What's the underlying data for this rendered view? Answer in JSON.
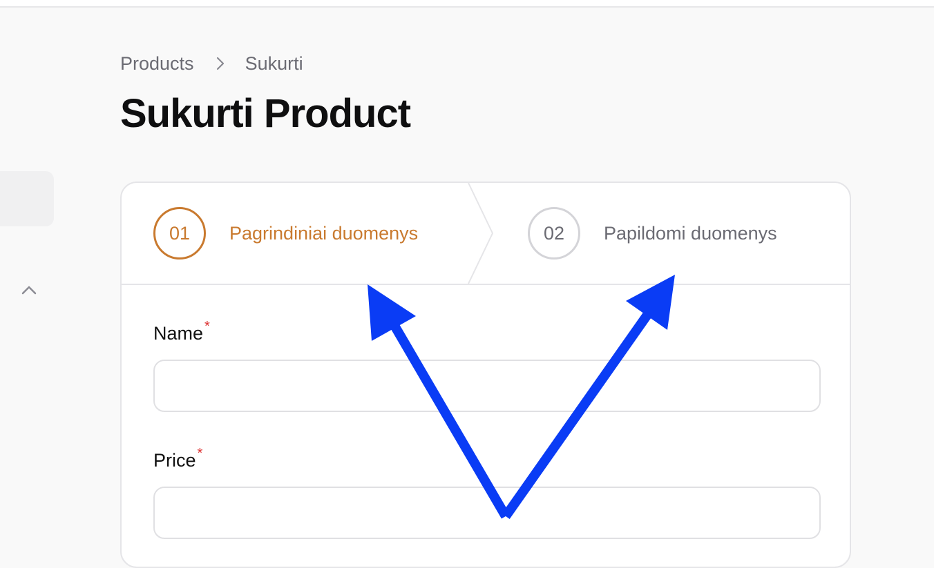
{
  "breadcrumb": {
    "parent": "Products",
    "current": "Sukurti"
  },
  "page": {
    "title": "Sukurti Product"
  },
  "wizard": {
    "steps": [
      {
        "number": "01",
        "label": "Pagrindiniai duomenys",
        "state": "active"
      },
      {
        "number": "02",
        "label": "Papildomi duomenys",
        "state": "inactive"
      }
    ]
  },
  "form": {
    "fields": [
      {
        "label": "Name",
        "required_mark": "*",
        "value": ""
      },
      {
        "label": "Price",
        "required_mark": "*",
        "value": ""
      }
    ]
  },
  "colors": {
    "accent": "#c97a2f",
    "annotation_arrow": "#0a3cf5",
    "required": "#dd3333"
  },
  "icons": {
    "breadcrumb_separator": "chevron-right-icon",
    "sidebar_toggle": "chevron-up-icon"
  }
}
